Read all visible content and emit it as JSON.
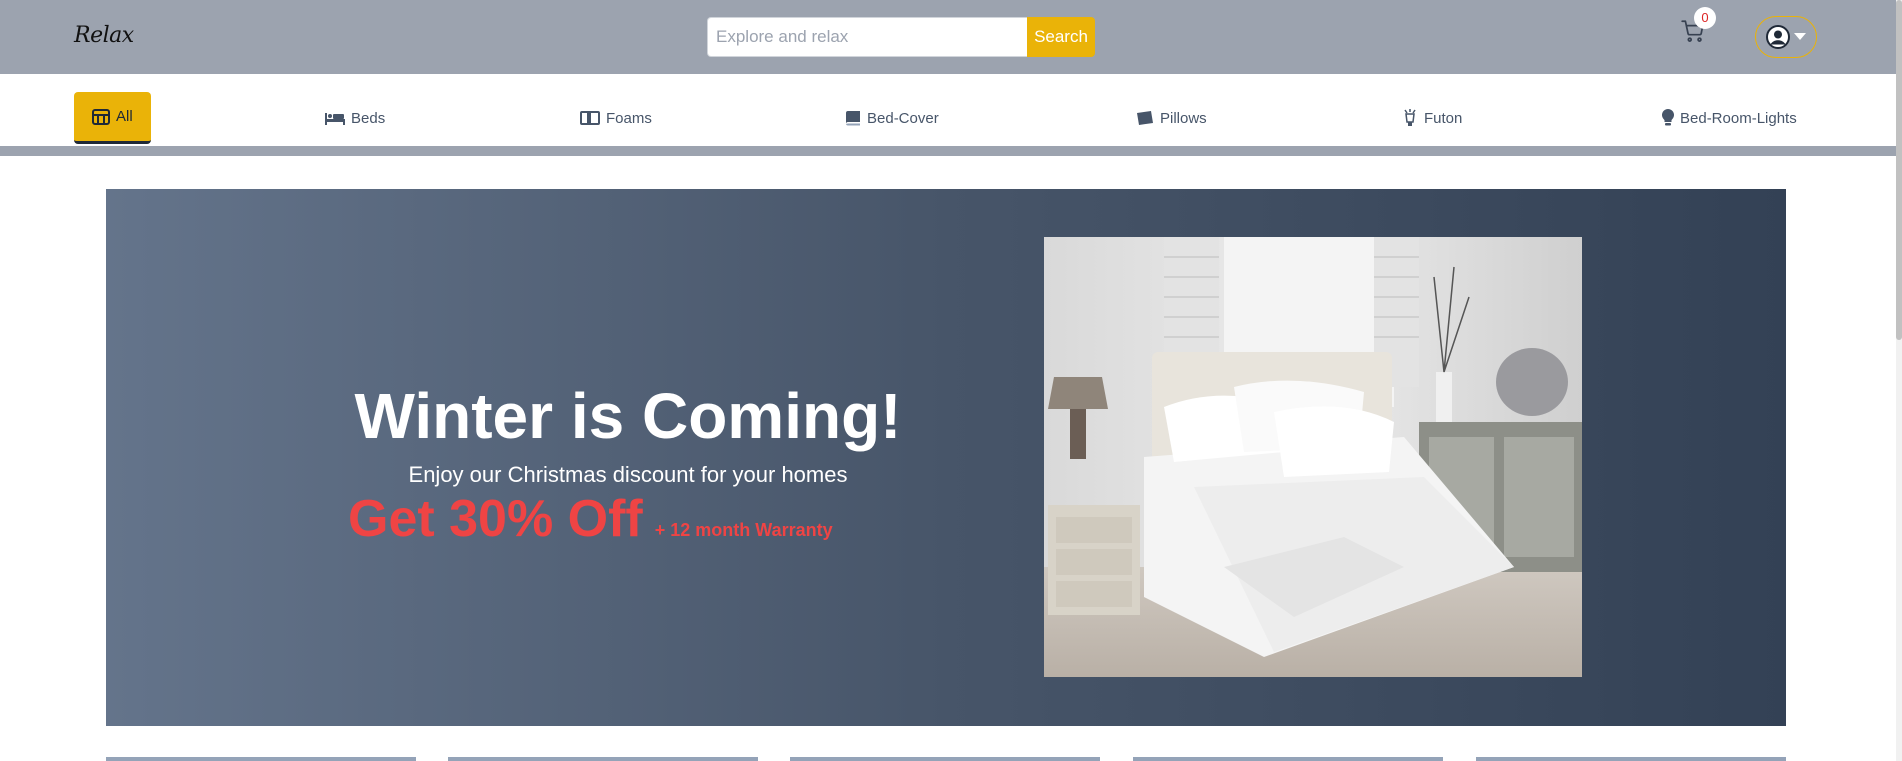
{
  "header": {
    "logo": "Relax",
    "search_placeholder": "Explore and relax",
    "search_label": "Search",
    "cart_count": "0"
  },
  "categories": [
    {
      "label": "All",
      "icon": "store-icon",
      "active": true
    },
    {
      "label": "Beds",
      "icon": "bed-icon"
    },
    {
      "label": "Foams",
      "icon": "foam-icon"
    },
    {
      "label": "Bed-Cover",
      "icon": "book-cover-icon"
    },
    {
      "label": "Pillows",
      "icon": "pillow-icon"
    },
    {
      "label": "Futon",
      "icon": "futon-icon"
    },
    {
      "label": "Bed-Room-Lights",
      "icon": "lightbulb-icon"
    }
  ],
  "hero": {
    "title": "Winter is Coming!",
    "subtitle": "Enjoy our Christmas discount for your homes",
    "offer": "Get 30% Off",
    "offer_extra": "+ 12 month Warranty"
  },
  "colors": {
    "accent": "#eab308",
    "header_bg": "#9ca3af",
    "offer_red": "#ef4444"
  }
}
